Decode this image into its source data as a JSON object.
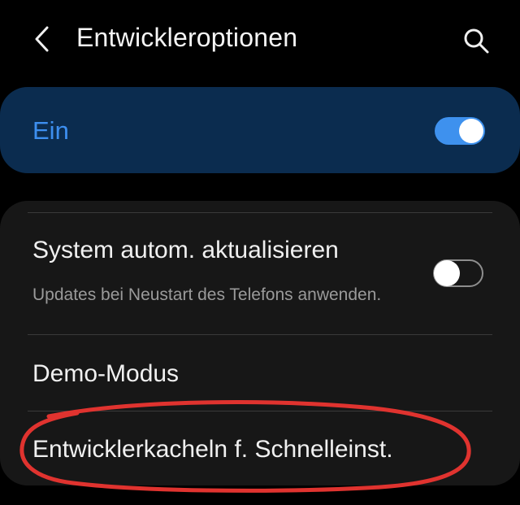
{
  "header": {
    "title": "Entwickleroptionen",
    "back_icon": "chevron-left-icon",
    "search_icon": "search-icon"
  },
  "master_switch": {
    "label": "Ein",
    "state": "on"
  },
  "settings": {
    "items": [
      {
        "title": "System autom. aktualisieren",
        "subtitle": "Updates bei Neustart des Telefons anwenden.",
        "toggle": "off"
      },
      {
        "title": "Demo-Modus"
      },
      {
        "title": "Entwicklerkacheln f. Schnelleinst."
      }
    ]
  },
  "colors": {
    "background": "#000000",
    "accent": "#3e91ee",
    "master_card": "#0b2c4f",
    "list_card": "#171717",
    "annotation": "#e0332f"
  }
}
